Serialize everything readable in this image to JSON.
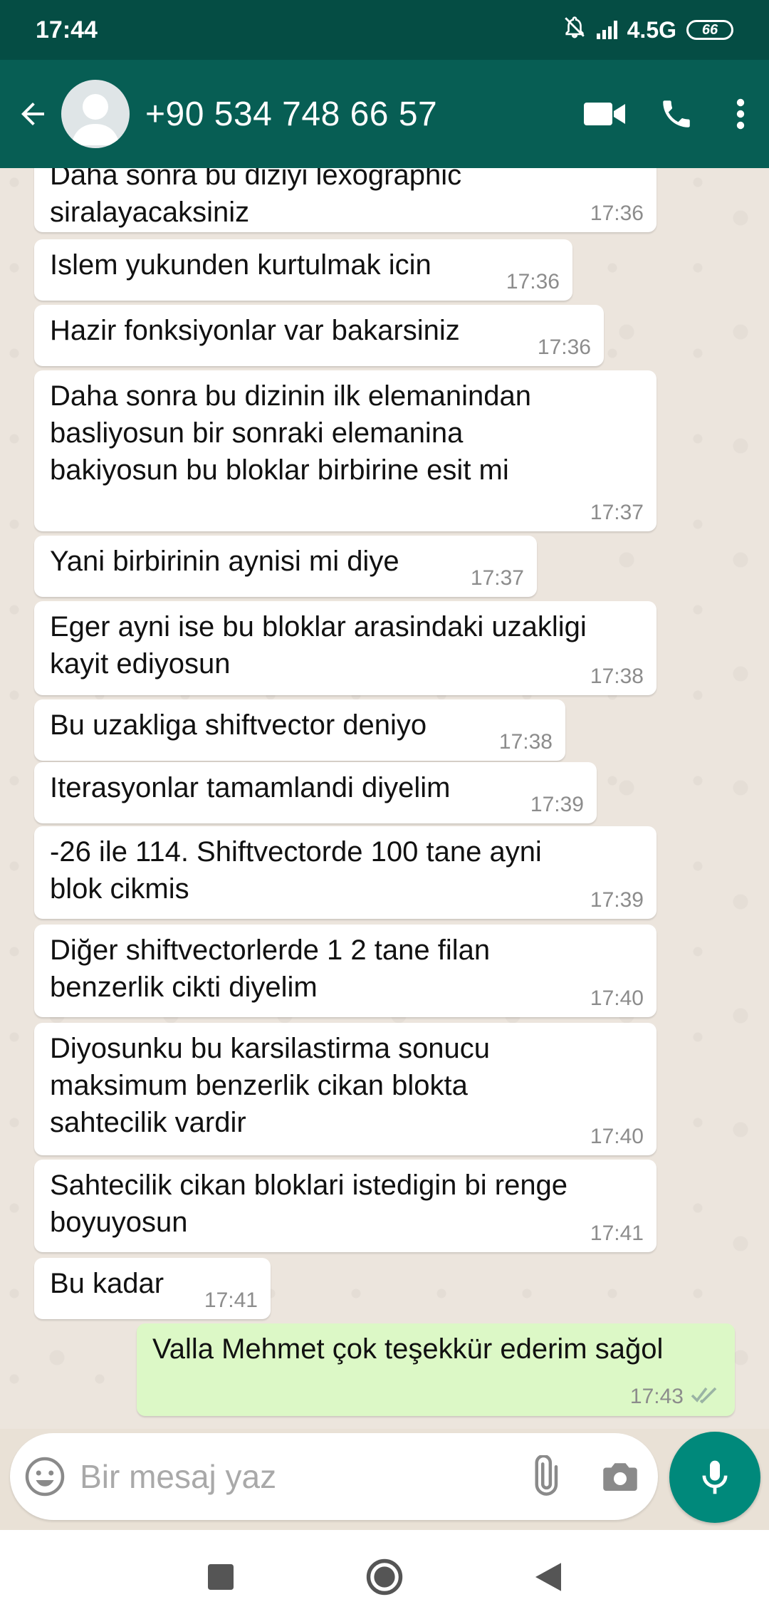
{
  "status_bar": {
    "time": "17:44",
    "network": "4.5G",
    "battery": "66"
  },
  "header": {
    "contact": "+90 534 748 66 57"
  },
  "messages": [
    {
      "dir": "in",
      "text": "Daha sonra bu diziyi lexographic\nsiralayacaksiniz",
      "time": "17:36"
    },
    {
      "dir": "in",
      "text": "Islem yukunden kurtulmak icin",
      "time": "17:36"
    },
    {
      "dir": "in",
      "text": "Hazir fonksiyonlar var bakarsiniz",
      "time": "17:36"
    },
    {
      "dir": "in",
      "text": "Daha sonra bu dizinin ilk elemanindan\nbasliyosun bir sonraki elemanina\nbakiyosun bu bloklar birbirine esit mi",
      "time": "17:37"
    },
    {
      "dir": "in",
      "text": "Yani birbirinin aynisi mi diye",
      "time": "17:37"
    },
    {
      "dir": "in",
      "text": "Eger ayni ise bu bloklar arasindaki uzakligi\nkayit ediyosun",
      "time": "17:38"
    },
    {
      "dir": "in",
      "text": "Bu uzakliga shiftvector deniyo",
      "time": "17:38"
    },
    {
      "dir": "in",
      "text": "Iterasyonlar tamamlandi diyelim",
      "time": "17:39"
    },
    {
      "dir": "in",
      "text": "-26 ile 114. Shiftvectorde 100 tane ayni\nblok cikmis",
      "time": "17:39"
    },
    {
      "dir": "in",
      "text": "Diğer shiftvectorlerde 1 2 tane filan\nbenzerlik cikti diyelim",
      "time": "17:40"
    },
    {
      "dir": "in",
      "text": "Diyosunku bu karsilastirma sonucu\nmaksimum benzerlik cikan blokta\nsahtecilik vardir",
      "time": "17:40"
    },
    {
      "dir": "in",
      "text": "Sahtecilik cikan bloklari istedigin bi renge\nboyuyosun",
      "time": "17:41"
    },
    {
      "dir": "in",
      "text": "Bu kadar",
      "time": "17:41"
    },
    {
      "dir": "out",
      "text": "Valla Mehmet çok teşekkür ederim sağol",
      "time": "17:43",
      "status": "read"
    }
  ],
  "composer": {
    "placeholder": "Bir mesaj yaz"
  },
  "colors": {
    "status_bar": "#054d44",
    "app_bar": "#075e54",
    "incoming_bubble": "#ffffff",
    "outgoing_bubble": "#dcf8c6",
    "mic_button": "#00897b",
    "read_ticks": "#4fc3f7"
  },
  "icons": [
    "back-arrow-icon",
    "avatar-icon",
    "video-call-icon",
    "voice-call-icon",
    "menu-icon",
    "emoji-icon",
    "attach-icon",
    "camera-icon",
    "mic-icon",
    "recents-icon",
    "home-icon",
    "back-icon"
  ]
}
